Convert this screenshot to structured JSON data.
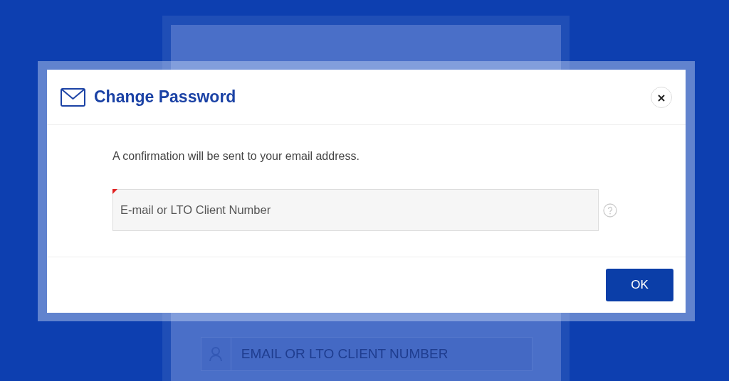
{
  "background_form": {
    "field": {
      "placeholder": "EMAIL OR LTO CLIENT NUMBER"
    }
  },
  "dialog": {
    "title": "Change Password",
    "message": "A confirmation will be sent to your email address.",
    "field": {
      "placeholder": "E-mail or LTO Client Number",
      "required": true
    },
    "buttons": [
      {
        "label": "OK"
      }
    ]
  }
}
